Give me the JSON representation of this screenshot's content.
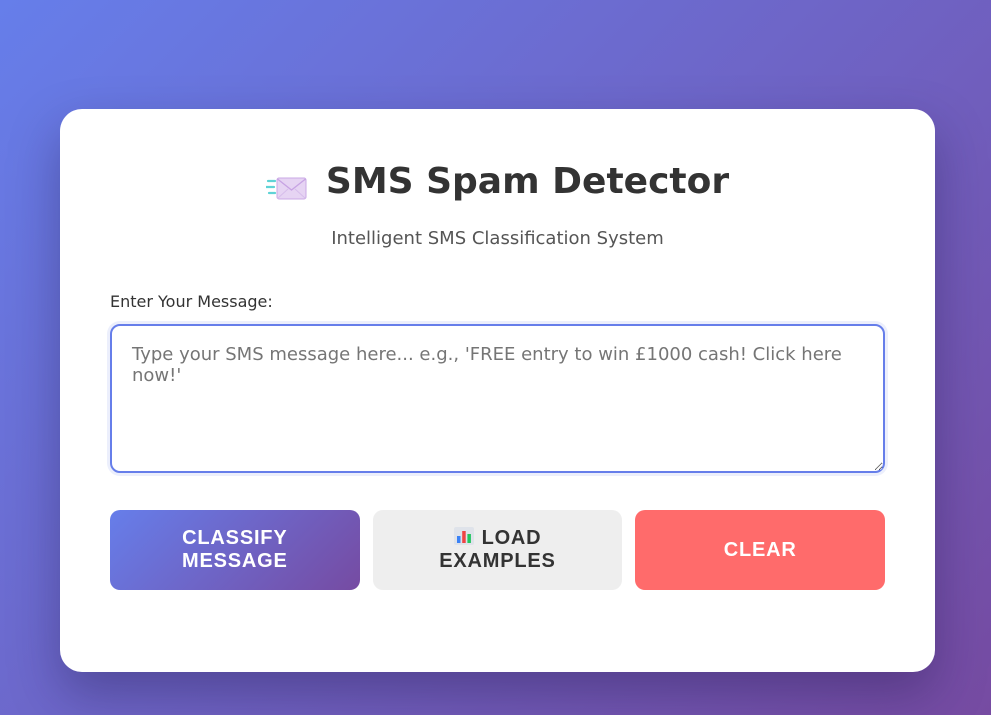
{
  "header": {
    "title": "SMS Spam Detector",
    "subtitle": "Intelligent SMS Classification System",
    "icon": "envelope-with-motion-lines-icon"
  },
  "form": {
    "label": "Enter Your Message:",
    "value": "",
    "placeholder": "Type your SMS message here... e.g., 'FREE entry to win £1000 cash! Click here now!'"
  },
  "buttons": {
    "classify_label": "CLASSIFY MESSAGE",
    "load_label": "LOAD EXAMPLES",
    "load_icon": "bar-chart-icon",
    "clear_label": "CLEAR"
  },
  "colors": {
    "gradient_start": "#667eea",
    "gradient_end": "#764ba2",
    "clear_button": "#ff6b6b",
    "load_button": "#eeeeee"
  }
}
